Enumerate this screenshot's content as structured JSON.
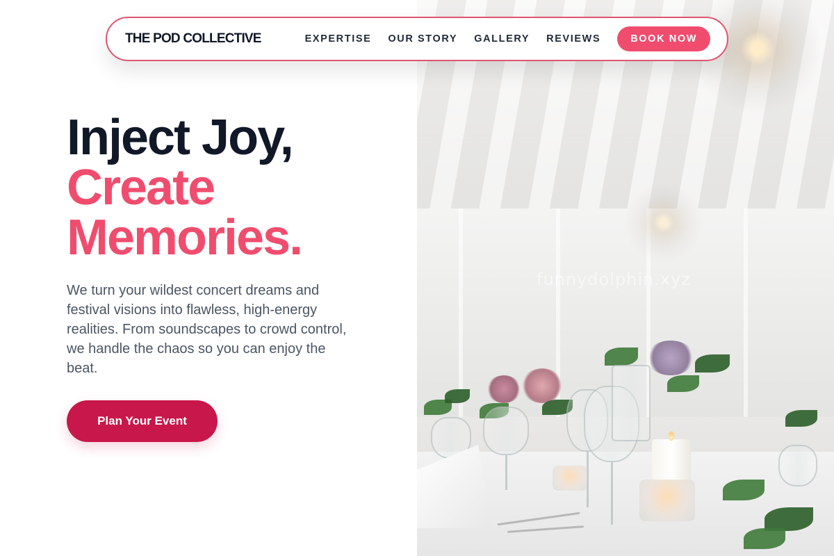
{
  "nav": {
    "brand": "THE POD COLLECTIVE",
    "links": [
      "EXPERTISE",
      "OUR STORY",
      "GALLERY",
      "REVIEWS"
    ],
    "cta_label": "BOOK NOW"
  },
  "hero": {
    "headline_line1": "Inject Joy,",
    "headline_line2": "Create",
    "headline_line3": "Memories.",
    "description": "We turn your wildest concert dreams and festival visions into flawless, high-energy realities. From soundscapes to crowd control, we handle the chaos so you can enjoy the beat.",
    "cta_label": "Plan Your Event"
  },
  "image": {
    "watermark": "funnydolphin.xyz"
  },
  "colors": {
    "accent_pink": "#f04d6e",
    "cta_crimson": "#c8174a",
    "heading_dark": "#111827",
    "body_gray": "#4b5563"
  }
}
